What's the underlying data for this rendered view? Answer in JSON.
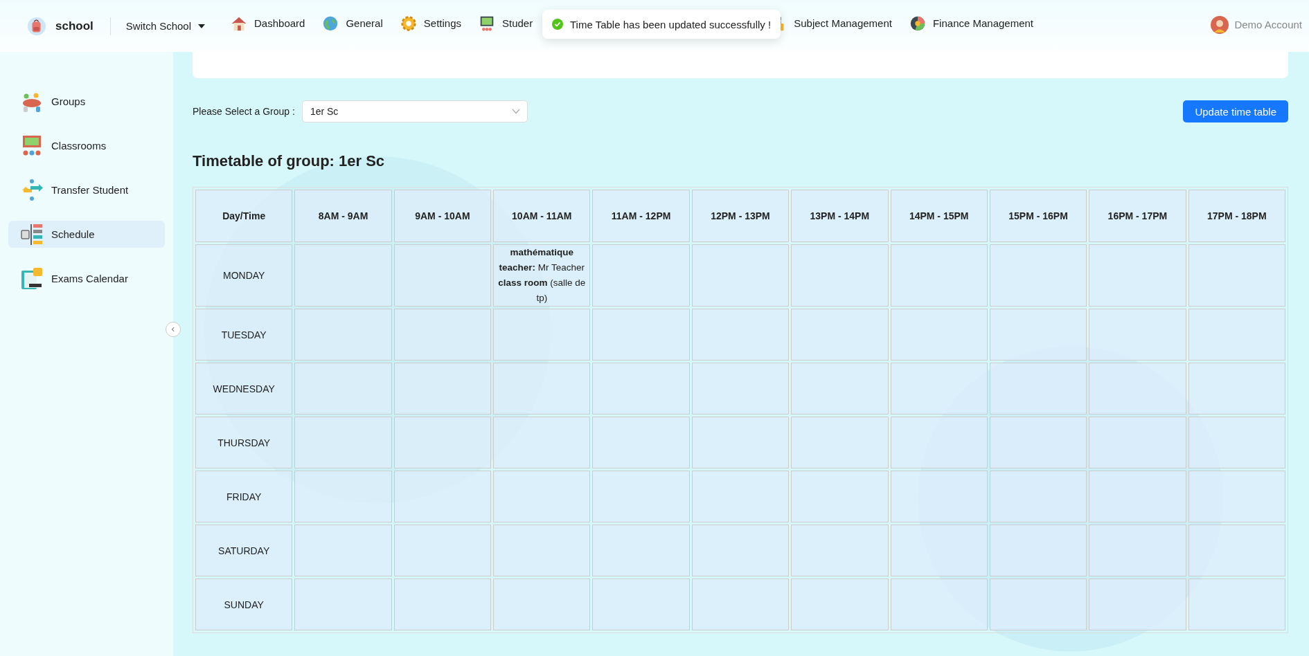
{
  "header": {
    "brand": "school",
    "switch_school": "Switch School",
    "nav": [
      {
        "label": "Dashboard"
      },
      {
        "label": "General"
      },
      {
        "label": "Settings"
      },
      {
        "label": "Studer"
      },
      {
        "label": "Subject Management"
      },
      {
        "label": "Finance Management"
      }
    ],
    "account": "Demo Account"
  },
  "toast": {
    "message": "Time Table has been updated successfully !"
  },
  "sidebar": {
    "items": [
      {
        "label": "Groups",
        "selected": false
      },
      {
        "label": "Classrooms",
        "selected": false
      },
      {
        "label": "Transfer Student",
        "selected": false
      },
      {
        "label": "Schedule",
        "selected": true
      },
      {
        "label": "Exams Calendar",
        "selected": false
      }
    ]
  },
  "group_select": {
    "label": "Please Select a Group :",
    "value": "1er Sc"
  },
  "update_button": "Update time table",
  "title": "Timetable of group: 1er Sc",
  "table": {
    "columns": [
      "Day/Time",
      "8AM - 9AM",
      "9AM - 10AM",
      "10AM - 11AM",
      "11AM - 12PM",
      "12PM - 13PM",
      "13PM - 14PM",
      "14PM - 15PM",
      "15PM - 16PM",
      "16PM - 17PM",
      "17PM - 18PM"
    ],
    "rows": [
      {
        "cells": [
          "MONDAY",
          "",
          "",
          {
            "subject": "mathématique",
            "details": [
              "**teacher:** Mr Teacher",
              "**class room** (salle de tp)"
            ]
          },
          "",
          "",
          "",
          "",
          "",
          "",
          ""
        ]
      },
      {
        "cells": [
          "TUESDAY",
          "",
          "",
          "",
          "",
          "",
          "",
          "",
          "",
          "",
          ""
        ]
      },
      {
        "cells": [
          "WEDNESDAY",
          "",
          "",
          "",
          "",
          "",
          "",
          "",
          "",
          "",
          ""
        ]
      },
      {
        "cells": [
          "THURSDAY",
          "",
          "",
          "",
          "",
          "",
          "",
          "",
          "",
          "",
          ""
        ]
      },
      {
        "cells": [
          "FRIDAY",
          "",
          "",
          "",
          "",
          "",
          "",
          "",
          "",
          "",
          ""
        ]
      },
      {
        "cells": [
          "SATURDAY",
          "",
          "",
          "",
          "",
          "",
          "",
          "",
          "",
          "",
          ""
        ]
      },
      {
        "cells": [
          "SUNDAY",
          "",
          "",
          "",
          "",
          "",
          "",
          "",
          "",
          "",
          ""
        ]
      }
    ]
  }
}
